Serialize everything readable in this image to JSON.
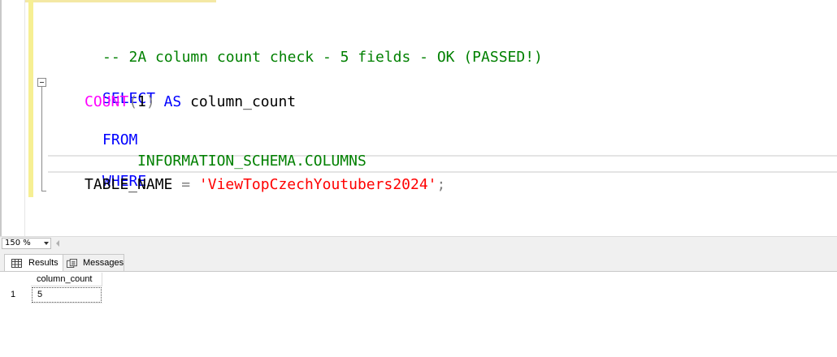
{
  "editor": {
    "comment": "-- 2A column count check - 5 fields - OK (PASSED!)",
    "line_select": "SELECT",
    "line2": {
      "fn": "COUNT",
      "open_paren": "(",
      "number": "1",
      "close_paren": ")",
      "as_kw": "AS",
      "alias": "column_count"
    },
    "line_from": "FROM",
    "line_table": "INFORMATION_SCHEMA.COLUMNS",
    "line_where": "WHERE",
    "line6": {
      "column": "TABLE_NAME",
      "equals": "=",
      "value": "'ViewTopCzechYoutubers2024'",
      "semicolon": ";"
    }
  },
  "zoom": {
    "value": "150 %"
  },
  "tabs": {
    "results_label": "Results",
    "messages_label": "Messages"
  },
  "results": {
    "columns": [
      "column_count"
    ],
    "rows": [
      {
        "row_number": "1",
        "values": [
          "5"
        ]
      }
    ]
  },
  "colors": {
    "keyword": "#0000ff",
    "function": "#ff00ff",
    "string": "#ff0000",
    "comment": "#008000",
    "system_object": "#008000",
    "change_bar": "#f6ef93"
  }
}
